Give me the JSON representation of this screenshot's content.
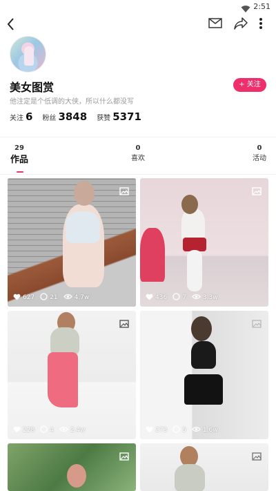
{
  "status": {
    "time": "2:51"
  },
  "profile": {
    "name": "美女图赏",
    "bio": "他注定是个低调的大侠，所以什么都没写",
    "follow_button": "+ 关注",
    "stats": [
      {
        "label": "关注",
        "value": "6"
      },
      {
        "label": "粉丝",
        "value": "3848"
      },
      {
        "label": "获赞",
        "value": "5371"
      }
    ]
  },
  "tabs": [
    {
      "count": "29",
      "label": "作品",
      "active": true
    },
    {
      "count": "0",
      "label": "喜欢",
      "active": false
    },
    {
      "count": "0",
      "label": "活动",
      "active": false
    }
  ],
  "posts": [
    {
      "likes": "627",
      "comments": "21",
      "views": "4.7w"
    },
    {
      "likes": "436",
      "comments": "7",
      "views": "3.3w"
    },
    {
      "likes": "228",
      "comments": "4",
      "views": "2.4w"
    },
    {
      "likes": "273",
      "comments": "5",
      "views": "1.6w"
    },
    {
      "likes": "",
      "comments": "",
      "views": ""
    },
    {
      "likes": "",
      "comments": "",
      "views": ""
    }
  ],
  "colors": {
    "accent": "#ef2f6b"
  }
}
